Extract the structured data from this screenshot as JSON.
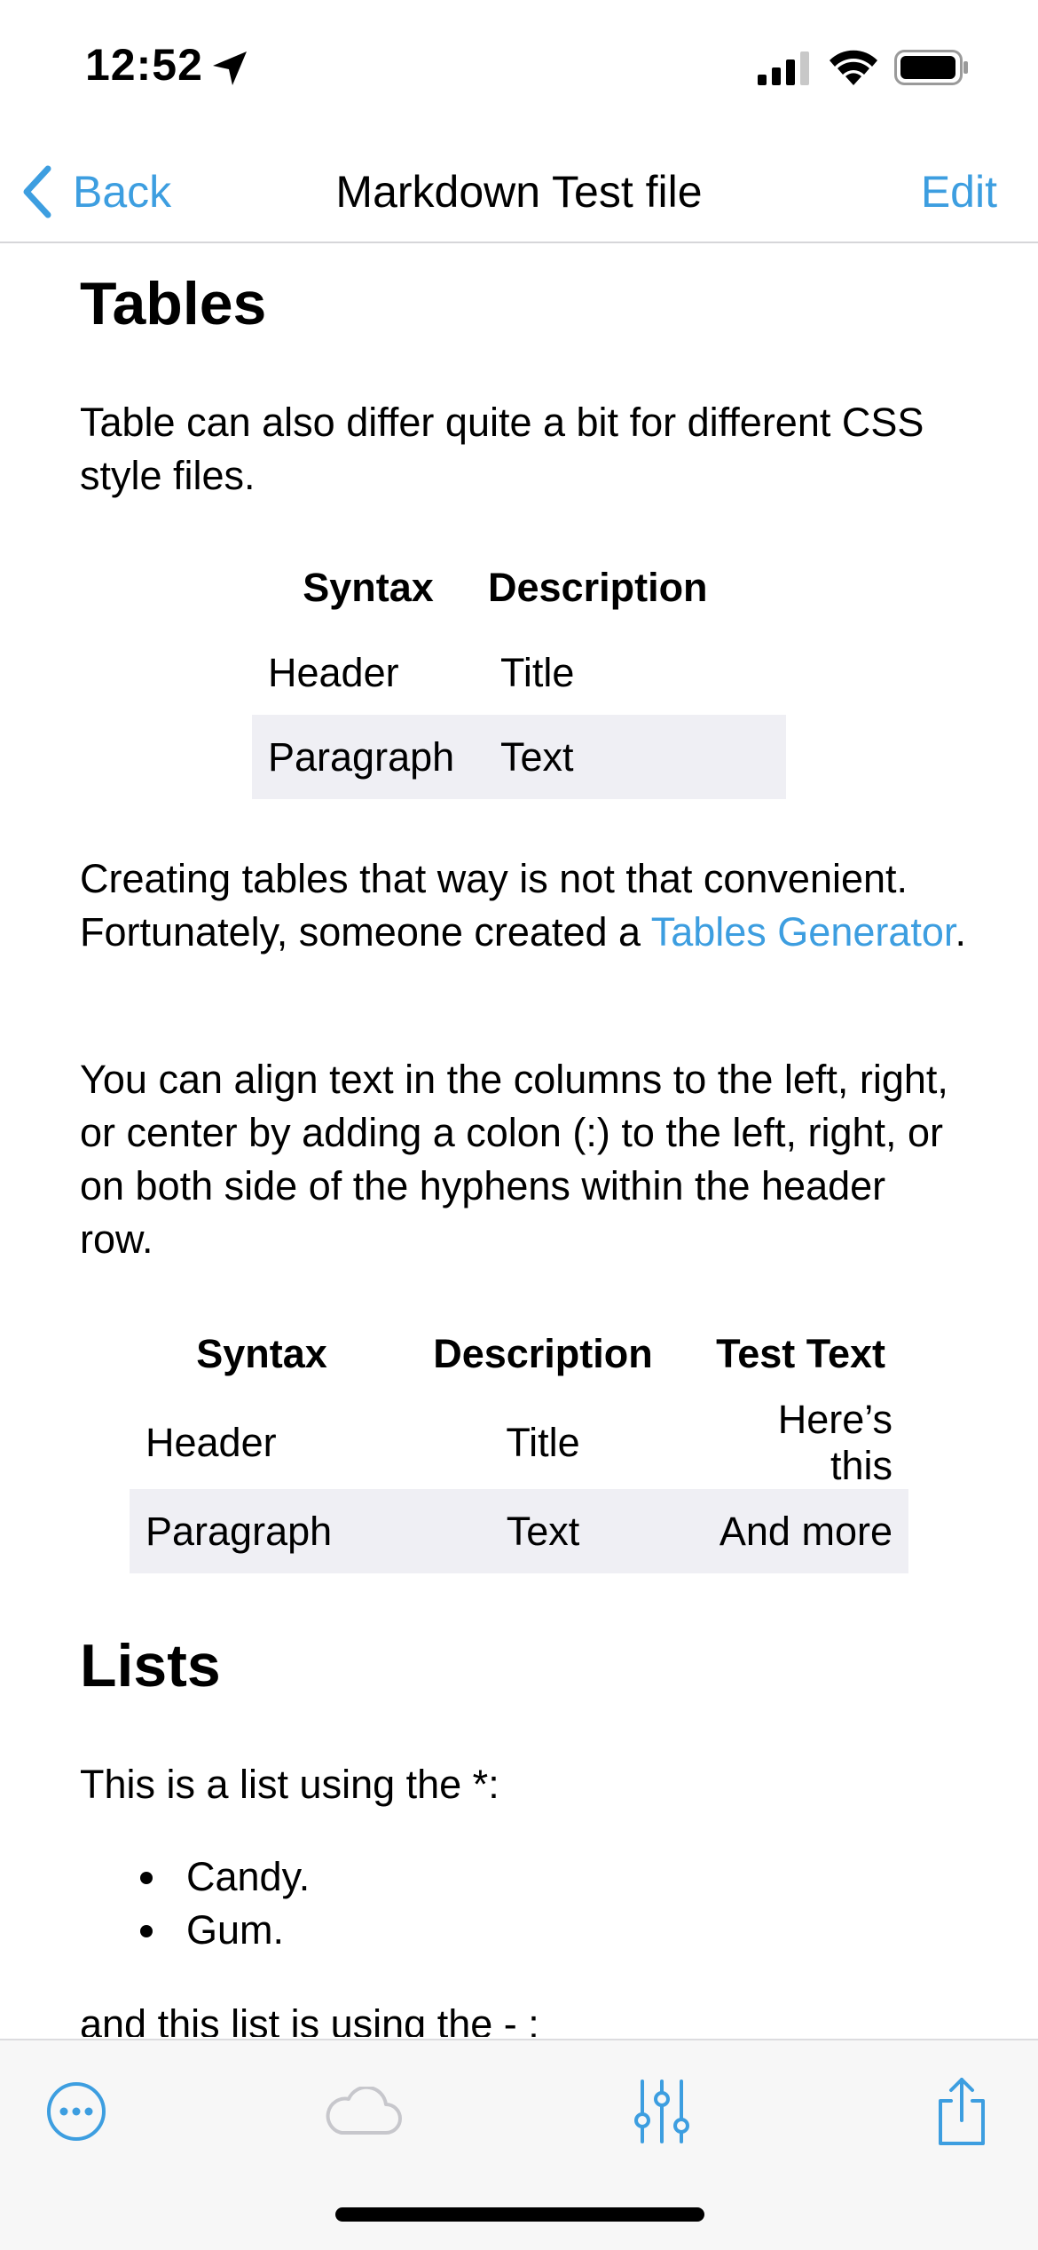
{
  "status_bar": {
    "time": "12:52"
  },
  "nav": {
    "back_label": "Back",
    "title": "Markdown Test file",
    "edit_label": "Edit"
  },
  "content": {
    "tables_heading": "Tables",
    "tables_intro": "Table can also differ quite a bit for different CSS style files.",
    "table1": {
      "headers": [
        "Syntax",
        "Description"
      ],
      "rows": [
        [
          "Header",
          "Title"
        ],
        [
          "Paragraph",
          "Text"
        ]
      ]
    },
    "creating_text_before": "Creating tables that way is not that convenient. Fortunately, someone created a ",
    "creating_link": "Tables Generator",
    "creating_text_after": ".",
    "align_text": "You can align text in the columns to the left, right, or center by adding a colon (:) to the left, right, or on both side of the hyphens within the header row.",
    "table2": {
      "headers": [
        "Syntax",
        "Description",
        "Test Text"
      ],
      "rows": [
        [
          "Header",
          "Title",
          "Here’s this"
        ],
        [
          "Paragraph",
          "Text",
          "And more"
        ]
      ]
    },
    "lists_heading": "Lists",
    "list_intro": "This is a list using the *:",
    "list_items": [
      "Candy.",
      "Gum."
    ],
    "list_next": "and this list is using the - :"
  },
  "toolbar": {
    "icons": [
      "more-icon",
      "cloud-icon",
      "sliders-icon",
      "share-icon"
    ],
    "accent_color": "#3d9ee0",
    "disabled_color": "#c7c7cc"
  }
}
